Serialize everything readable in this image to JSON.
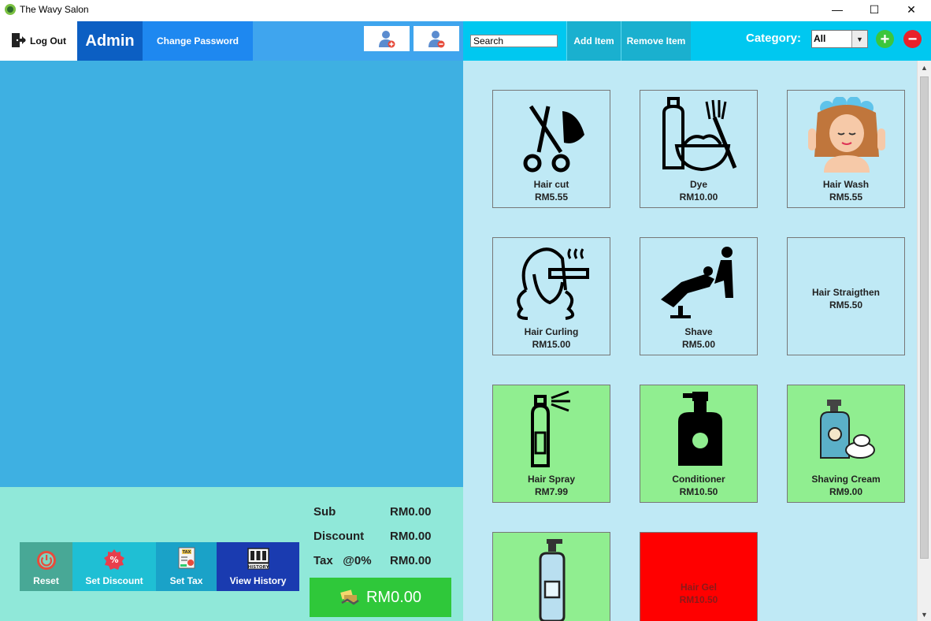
{
  "window": {
    "title": "The Wavy Salon",
    "controls": [
      "—",
      "☐",
      "✕"
    ]
  },
  "header": {
    "logout_label": "Log Out",
    "role": "Admin",
    "change_password_label": "Change Password",
    "search_value": "Search",
    "add_item_label": "Add Item",
    "remove_item_label": "Remove Item",
    "category_label": "Category:",
    "category_selected": "All",
    "add_category_symbol": "+",
    "remove_category_symbol": "−"
  },
  "actions": {
    "reset": "Reset",
    "set_discount": "Set Discount",
    "set_tax": "Set Tax",
    "view_history": "View History"
  },
  "totals": {
    "sub_label": "Sub",
    "sub_value": "RM0.00",
    "discount_label": "Discount",
    "discount_value": "RM0.00",
    "tax_label": "Tax   @0%",
    "tax_value": "RM0.00",
    "total": "RM0.00"
  },
  "items": [
    {
      "name": "Hair cut",
      "price": "RM5.55",
      "bg": "#f5fcfd",
      "icon": "scissors-icon"
    },
    {
      "name": "Dye",
      "price": "RM10.00",
      "bg": "#f5fcfd",
      "icon": "dye-icon"
    },
    {
      "name": "Hair Wash",
      "price": "RM5.55",
      "bg": "#f5fcfd",
      "icon": "hair-wash-icon"
    },
    {
      "name": "Hair Curling",
      "price": "RM15.00",
      "bg": "#f5fcfd",
      "icon": "hair-curling-icon"
    },
    {
      "name": "Shave",
      "price": "RM5.00",
      "bg": "#f5fcfd",
      "icon": "shave-icon"
    },
    {
      "name": "Hair Straigthen",
      "price": "RM5.50",
      "bg": "#f5fcfd",
      "icon": ""
    },
    {
      "name": "Hair Spray",
      "price": "RM7.99",
      "bg": "#90ee90",
      "icon": "hair-spray-icon"
    },
    {
      "name": "Conditioner",
      "price": "RM10.50",
      "bg": "#90ee90",
      "icon": "conditioner-icon"
    },
    {
      "name": "Shaving Cream",
      "price": "RM9.00",
      "bg": "#90ee90",
      "icon": "shaving-cream-icon"
    },
    {
      "name": "",
      "price": "",
      "bg": "#90ee90",
      "icon": "lotion-bottle-icon"
    },
    {
      "name": "Hair Gel",
      "price": "RM10.50",
      "bg": "#ff0000",
      "icon": ""
    }
  ],
  "colors": {
    "cart_bg": "#3eb0e2",
    "bottom_bg": "#90e8d9",
    "grid_bg": "#bfe9f5",
    "topbar": "#00c8f0",
    "admin": "#0c5fc3",
    "pay": "#2fc83a"
  }
}
